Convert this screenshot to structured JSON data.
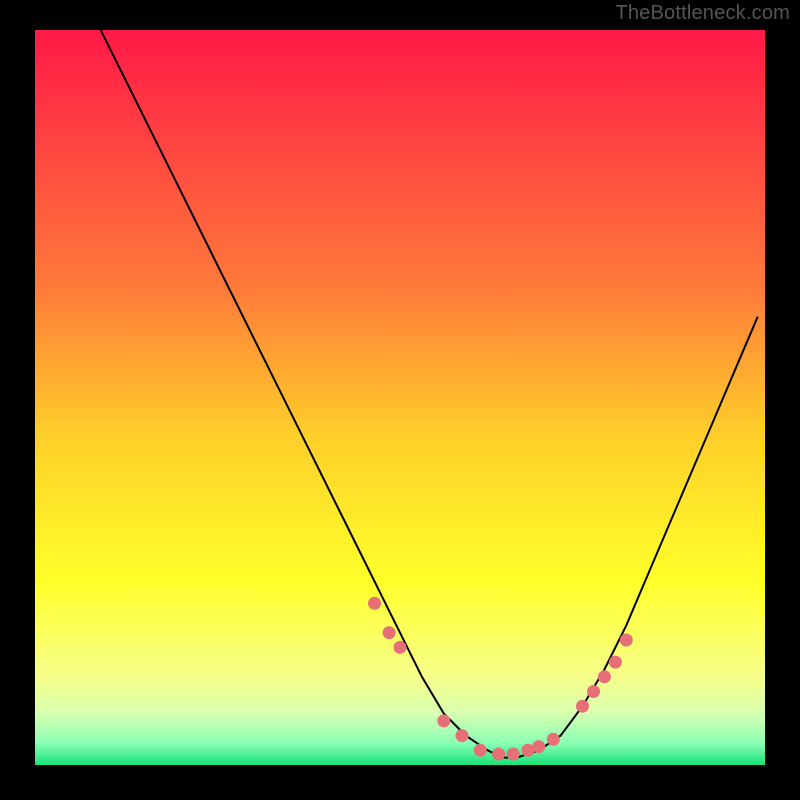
{
  "attribution": "TheBottleneck.com",
  "chart_data": {
    "type": "line",
    "title": "",
    "xlabel": "",
    "ylabel": "",
    "xlim": [
      0,
      100
    ],
    "ylim": [
      0,
      100
    ],
    "grid": false,
    "legend": false,
    "gradient_bg": {
      "stops": [
        {
          "offset": 0.0,
          "color": "#ff1947"
        },
        {
          "offset": 0.35,
          "color": "#ff7a3a"
        },
        {
          "offset": 0.55,
          "color": "#ffce2a"
        },
        {
          "offset": 0.75,
          "color": "#ffff2a"
        },
        {
          "offset": 0.88,
          "color": "#f7ff8a"
        },
        {
          "offset": 0.93,
          "color": "#d7ffb0"
        },
        {
          "offset": 0.97,
          "color": "#8affb5"
        },
        {
          "offset": 1.0,
          "color": "#18e278"
        }
      ]
    },
    "series": [
      {
        "name": "bottleneck-curve",
        "color": "#000000",
        "x": [
          9,
          11,
          14,
          17,
          20,
          23,
          26,
          29,
          32,
          35,
          38,
          41,
          44,
          47,
          50,
          53,
          56,
          59,
          62,
          64,
          66,
          69,
          72,
          75,
          78,
          81,
          84,
          87,
          90,
          93,
          96,
          99
        ],
        "y": [
          100,
          96,
          90,
          84,
          78,
          72,
          66,
          60,
          54,
          48,
          42,
          36,
          30,
          24,
          18,
          12,
          7,
          4,
          2,
          1,
          1,
          2,
          4,
          8,
          13,
          19,
          26,
          33,
          40,
          47,
          54,
          61
        ]
      }
    ],
    "markers": {
      "name": "highlight-points",
      "color": "#e76f78",
      "radius": 6.5,
      "x": [
        46.5,
        48.5,
        50.0,
        56.0,
        58.5,
        61.0,
        63.5,
        65.5,
        67.5,
        69.0,
        71.0,
        75.0,
        76.5,
        78.0,
        79.5,
        81.0
      ],
      "y": [
        22.0,
        18.0,
        16.0,
        6.0,
        4.0,
        2.0,
        1.5,
        1.5,
        2.0,
        2.5,
        3.5,
        8.0,
        10.0,
        12.0,
        14.0,
        17.0
      ]
    }
  }
}
